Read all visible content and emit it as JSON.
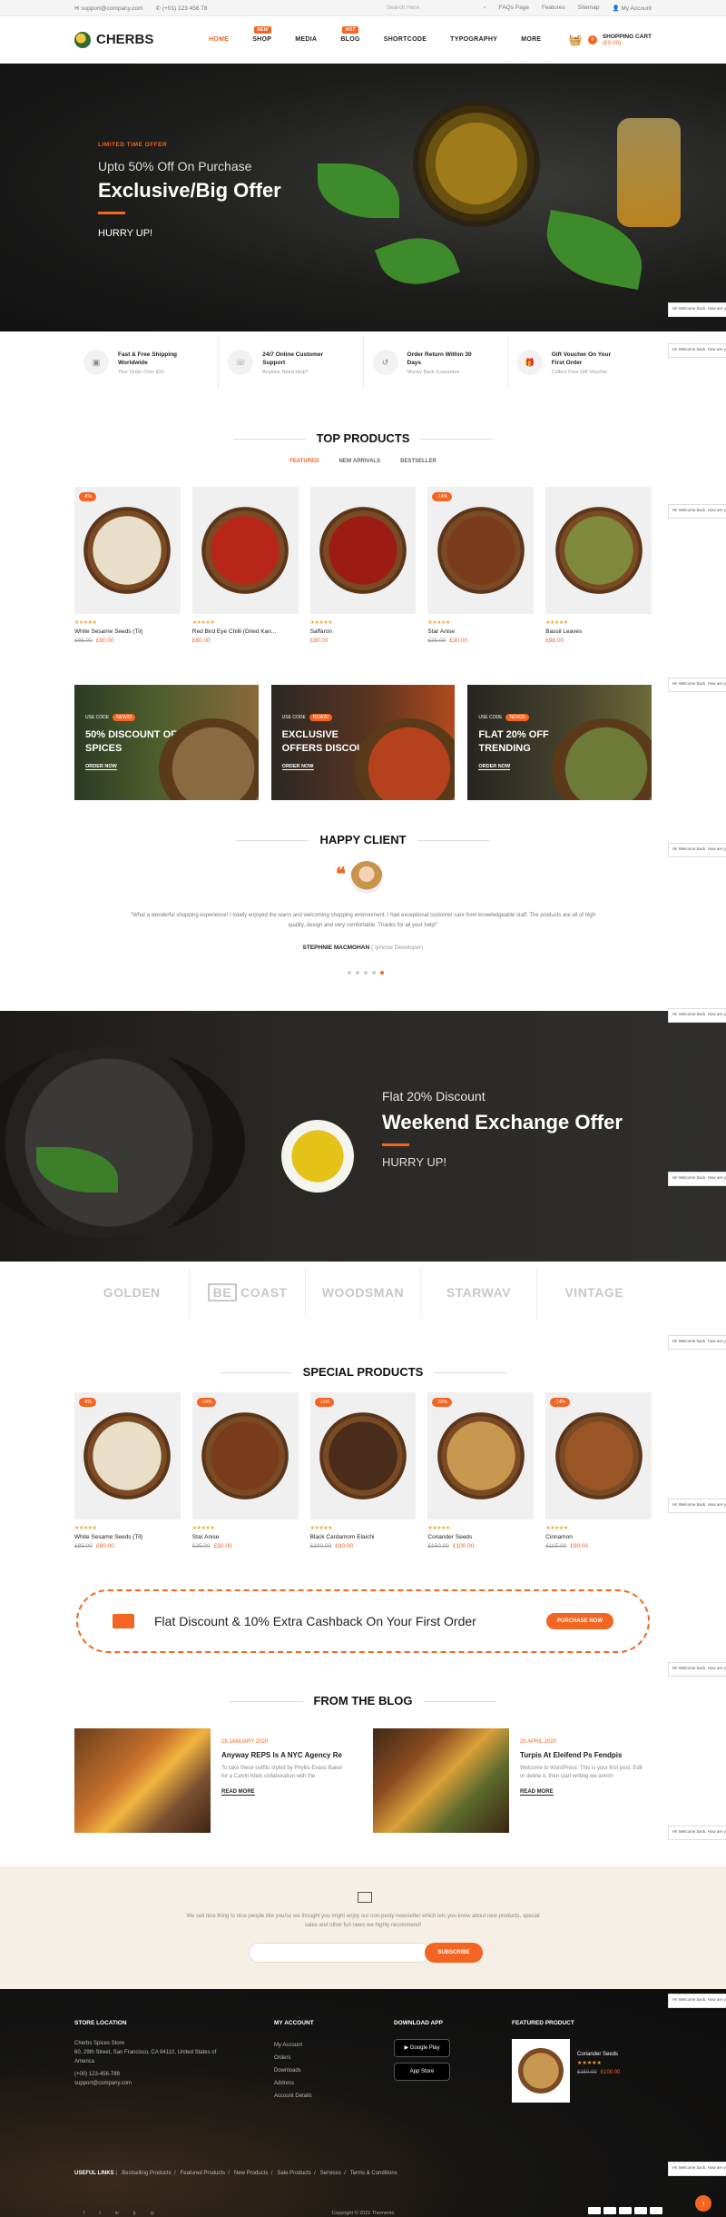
{
  "topbar": {
    "email": "support@company.com",
    "phone": "(+01) 123 456 78",
    "search_placeholder": "Search Here",
    "links": [
      "FAQs Page",
      "Features",
      "Sitemap",
      "My Account"
    ]
  },
  "brand": {
    "name": "CHERBS"
  },
  "nav": [
    {
      "label": "HOME",
      "active": true
    },
    {
      "label": "SHOP",
      "badge": "NEW"
    },
    {
      "label": "MEDIA"
    },
    {
      "label": "BLOG",
      "badge": "HOT"
    },
    {
      "label": "SHORTCODE"
    },
    {
      "label": "TYPOGRAPHY"
    },
    {
      "label": "MORE"
    }
  ],
  "cart": {
    "label": "SHOPPING CART",
    "amount": "(£0.00)",
    "count": "0"
  },
  "hero": {
    "tag": "LIMITED TIME OFFER",
    "sub": "Upto 50% Off On Purchase",
    "title": "Exclusive/Big Offer",
    "cta": "HURRY UP!"
  },
  "chat_text": "Hi! Welcome back. How are you doing?",
  "features": [
    {
      "icon": "box-icon",
      "title": "Fast & Free Shipping Worldwide",
      "sub": "Your Order Over $10"
    },
    {
      "icon": "support-icon",
      "title": "24/7 Online Customer Support",
      "sub": "Anytime Need Help?"
    },
    {
      "icon": "return-icon",
      "title": "Order Return Within 30 Days",
      "sub": "Money Back Guarantee"
    },
    {
      "icon": "gift-icon",
      "title": "Gift Voucher On Your First Order",
      "sub": "Collect Free Gift Voucher"
    }
  ],
  "top_products": {
    "title": "TOP PRODUCTS",
    "tabs": [
      "FEATURED",
      "NEW ARRIVALS",
      "BESTSELLER"
    ],
    "items": [
      {
        "sale": "-8%",
        "name": "White Sesame Seeds (Til)",
        "old": "£85.00",
        "price": "£80.00",
        "color": "#e9dfc9"
      },
      {
        "sale": "",
        "name": "Red Bird Eye Chilli (Dried Kan...",
        "old": "",
        "price": "£80.00",
        "color": "#b8261a"
      },
      {
        "sale": "",
        "name": "Saffaron",
        "old": "",
        "price": "£80.00",
        "color": "#9c1c14"
      },
      {
        "sale": "-14%",
        "name": "Star Anise",
        "old": "£35.00",
        "price": "£30.00",
        "color": "#7a3b1c"
      },
      {
        "sale": "",
        "name": "Bassil Leaves",
        "old": "",
        "price": "£98.00",
        "color": "#7f8a3c"
      }
    ]
  },
  "banners": [
    {
      "code_label": "USE CODE",
      "code": "NEW20",
      "title": "50% DISCOUNT OF SPICES",
      "cta": "ORDER NOW",
      "color": "#8a6a40"
    },
    {
      "code_label": "USE CODE",
      "code": "NEW20",
      "title": "EXCLUSIVE OFFERS DISCOUNT",
      "cta": "ORDER NOW",
      "color": "#b5421c"
    },
    {
      "code_label": "USE CODE",
      "code": "NEW20",
      "title": "FLAT 20% OFF TRENDING",
      "cta": "ORDER NOW",
      "color": "#6e7a38"
    }
  ],
  "happy": {
    "title": "HAPPY CLIENT",
    "quote": "\"What a wonderful shopping experience! I totally enjoyed the warm and welcoming shopping environment. I had exceptional customer care from knowledgeable staff. The products are all of high quality, design and very comfortable. Thanks for all your help!\"",
    "name": "STEPHNIE MACMOHAN",
    "role": "( Iphone Developer)"
  },
  "weekend": {
    "sub": "Flat 20% Discount",
    "title": "Weekend Exchange Offer",
    "cta": "HURRY UP!"
  },
  "brands": [
    "GOLDEN",
    "COAST",
    "WOODSMAN",
    "STARWAV",
    "VINTAGE"
  ],
  "brand_be": "BE",
  "special_products": {
    "title": "SPECIAL PRODUCTS",
    "items": [
      {
        "sale": "-6%",
        "name": "White Sesame Seeds (Til)",
        "old": "£85.00",
        "price": "£80.00",
        "color": "#e9dfc9"
      },
      {
        "sale": "-14%",
        "name": "Star Anise",
        "old": "£35.00",
        "price": "£30.00",
        "color": "#7a3b1c"
      },
      {
        "sale": "-10%",
        "name": "Black Cardamom Elaichi",
        "old": "£100.00",
        "price": "£90.00",
        "color": "#4a2c1a"
      },
      {
        "sale": "-33%",
        "name": "Coriander Seeds",
        "old": "£150.00",
        "price": "£100.00",
        "color": "#c89850"
      },
      {
        "sale": "-14%",
        "name": "Cinnamon",
        "old": "£115.00",
        "price": "£99.00",
        "color": "#9a5526"
      }
    ]
  },
  "cashback": {
    "text": "Flat Discount & 10% Extra Cashback On Your First Order",
    "cta": "PURCHASE NOW"
  },
  "blog": {
    "title": "FROM THE BLOG",
    "posts": [
      {
        "date": "18 JANUARY 2020",
        "title": "Anyway REPS Is A NYC Agency Re",
        "text": "To take these outfits styled by Phyllis Evans Baker for a Calvin Klein collaboration with the",
        "cta": "READ MORE"
      },
      {
        "date": "20 APRIL 2020",
        "title": "Turpis At Eleifend Ps Fendpis",
        "text": "Welcome to WordPress. This is your first post. Edit or delete it, then start writing we annim",
        "cta": "READ MORE"
      }
    ]
  },
  "newsletter": {
    "text": "We sell nice thing to nice people like you/so we thought you might enjoy our non-pesty newsletter which lets you know about new products, special sales and other fun news we highly recommend!",
    "placeholder": "",
    "cta": "SUBSCRIBE"
  },
  "footer": {
    "store": {
      "title": "STORE LOCATION",
      "lines": [
        "Cherbs Spices Store",
        "60, 29th Street, San Francisco, CA 94110, United States of America",
        "(+00) 123-456-789",
        "support@company.com"
      ]
    },
    "account": {
      "title": "MY ACCOUNT",
      "links": [
        "My Account",
        "Orders",
        "Downloads",
        "Address",
        "Account Details"
      ]
    },
    "app": {
      "title": "DOWNLOAD APP",
      "google": "Google Play",
      "apple": "App Store"
    },
    "featured": {
      "title": "FEATURED PRODUCT",
      "name": "Coriander Seeds",
      "old": "£150.00",
      "price": "£100.00"
    },
    "useful_label": "USEFUL LINKS :",
    "useful": [
      "Bestselling Products",
      "Featured Products",
      "New Products",
      "Sale Products",
      "Services",
      "Terms & Conditions"
    ],
    "copyright": "Copyright © 2021 Themento"
  }
}
